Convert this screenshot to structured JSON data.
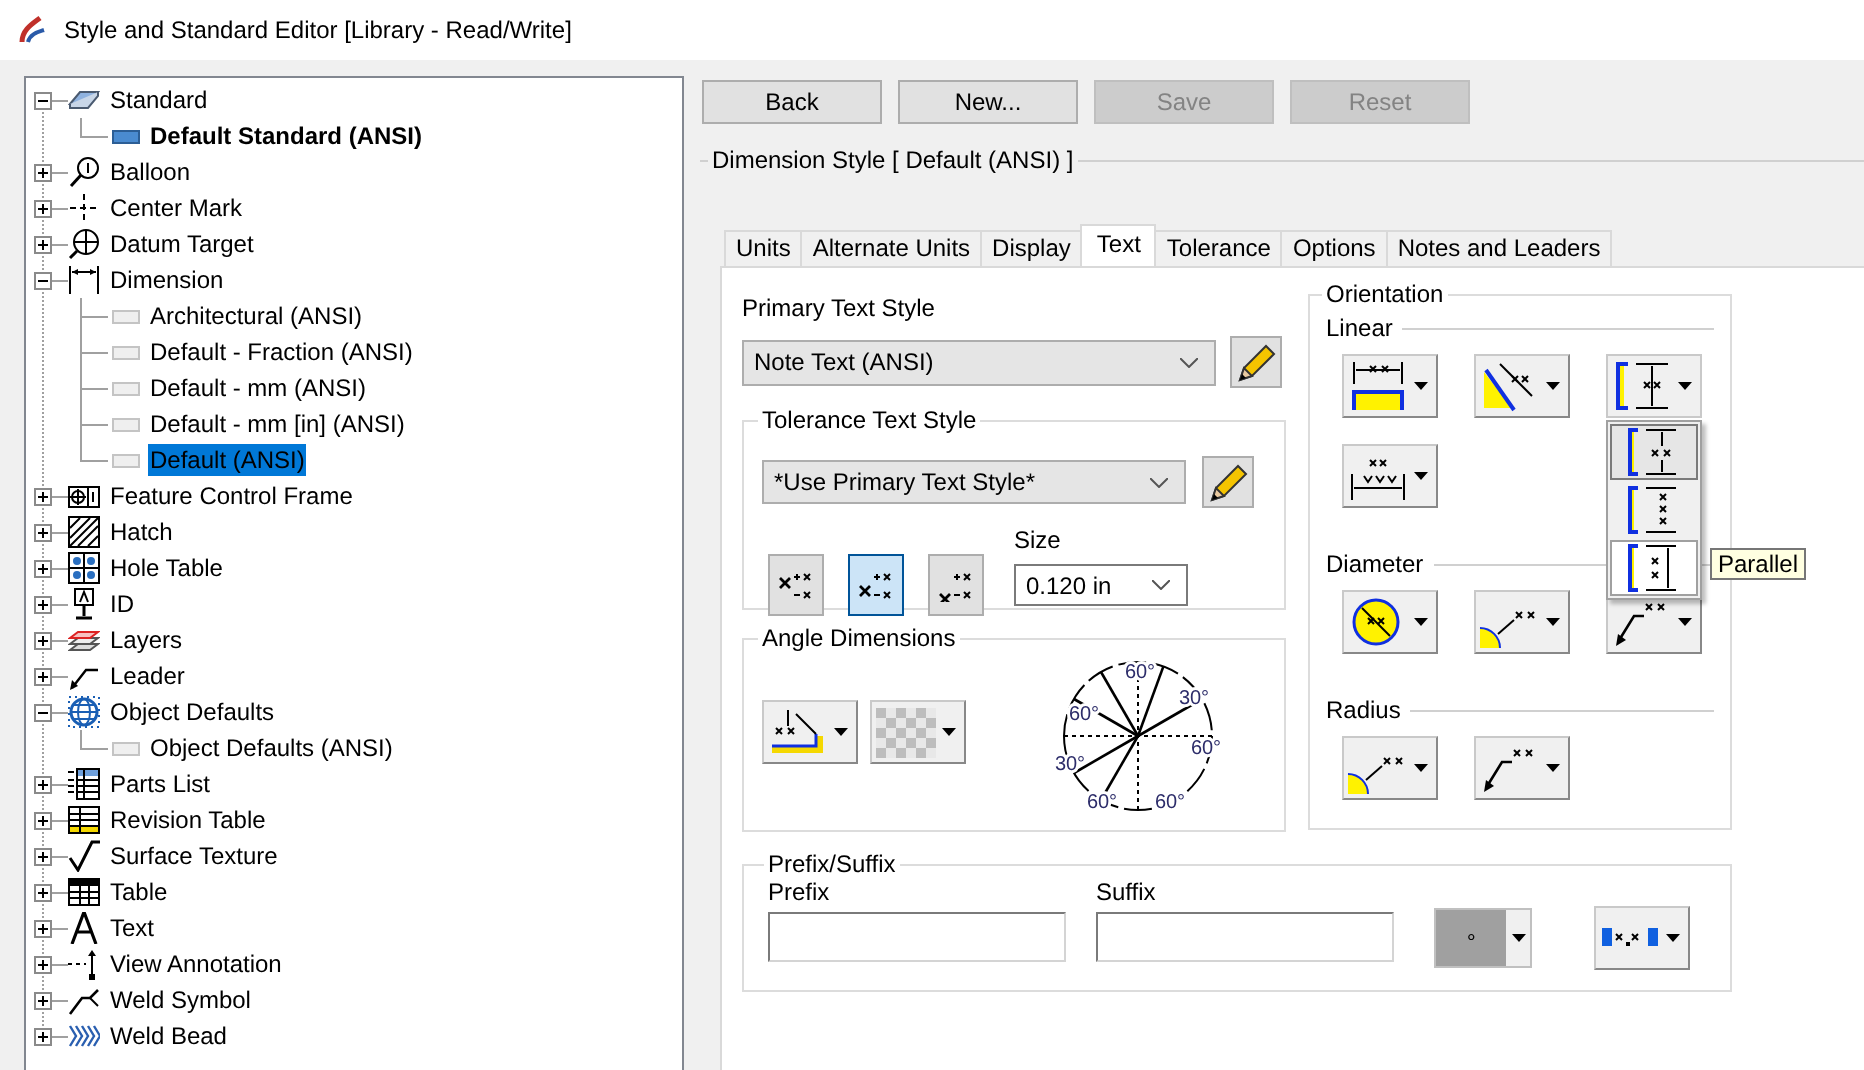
{
  "window": {
    "title": "Style and Standard Editor [Library - Read/Write]"
  },
  "tree": [
    {
      "label": "Standard",
      "kind": "standard",
      "expanded": true,
      "children": [
        {
          "label": "Default Standard (ANSI)",
          "kind": "standard-item",
          "active": true,
          "selected": false
        }
      ]
    },
    {
      "label": "Balloon",
      "kind": "balloon",
      "expanded": false
    },
    {
      "label": "Center Mark",
      "kind": "center-mark",
      "expanded": false
    },
    {
      "label": "Datum Target",
      "kind": "datum-target",
      "expanded": false
    },
    {
      "label": "Dimension",
      "kind": "dimension",
      "expanded": true,
      "children": [
        {
          "label": "Architectural (ANSI)",
          "kind": "style-item",
          "active": false,
          "selected": false
        },
        {
          "label": "Default - Fraction (ANSI)",
          "kind": "style-item",
          "active": false,
          "selected": false
        },
        {
          "label": "Default - mm (ANSI)",
          "kind": "style-item",
          "active": false,
          "selected": false
        },
        {
          "label": "Default - mm [in] (ANSI)",
          "kind": "style-item",
          "active": false,
          "selected": false
        },
        {
          "label": "Default (ANSI)",
          "kind": "style-item",
          "active": false,
          "selected": true
        }
      ]
    },
    {
      "label": "Feature Control Frame",
      "kind": "fcf",
      "expanded": false
    },
    {
      "label": "Hatch",
      "kind": "hatch",
      "expanded": false
    },
    {
      "label": "Hole Table",
      "kind": "hole-table",
      "expanded": false
    },
    {
      "label": "ID",
      "kind": "id",
      "expanded": false
    },
    {
      "label": "Layers",
      "kind": "layers",
      "expanded": false
    },
    {
      "label": "Leader",
      "kind": "leader",
      "expanded": false
    },
    {
      "label": "Object Defaults",
      "kind": "object-defaults",
      "expanded": true,
      "children": [
        {
          "label": "Object Defaults (ANSI)",
          "kind": "style-item",
          "active": false,
          "selected": false
        }
      ]
    },
    {
      "label": "Parts List",
      "kind": "parts-list",
      "expanded": false
    },
    {
      "label": "Revision Table",
      "kind": "revision-table",
      "expanded": false
    },
    {
      "label": "Surface Texture",
      "kind": "surface-texture",
      "expanded": false
    },
    {
      "label": "Table",
      "kind": "table",
      "expanded": false
    },
    {
      "label": "Text",
      "kind": "text",
      "expanded": false
    },
    {
      "label": "View Annotation",
      "kind": "view-annotation",
      "expanded": false
    },
    {
      "label": "Weld Symbol",
      "kind": "weld-symbol",
      "expanded": false
    },
    {
      "label": "Weld Bead",
      "kind": "weld-bead",
      "expanded": false
    }
  ],
  "toolbar": [
    {
      "label": "Back",
      "disabled": false
    },
    {
      "label": "New...",
      "disabled": false
    },
    {
      "label": "Save",
      "disabled": true
    },
    {
      "label": "Reset",
      "disabled": true
    }
  ],
  "style_header": "Dimension Style [ Default (ANSI) ]",
  "tabs": [
    {
      "label": "Units",
      "selected": false
    },
    {
      "label": "Alternate Units",
      "selected": false
    },
    {
      "label": "Display",
      "selected": false
    },
    {
      "label": "Text",
      "selected": true
    },
    {
      "label": "Tolerance",
      "selected": false
    },
    {
      "label": "Options",
      "selected": false
    },
    {
      "label": "Notes and Leaders",
      "selected": false
    }
  ],
  "primary_text_style": {
    "label": "Primary Text Style",
    "value": "Note Text (ANSI)"
  },
  "tolerance_text_style": {
    "title": "Tolerance Text Style",
    "value": "*Use Primary Text Style*",
    "stack_buttons": [
      {
        "kind": "top",
        "selected": false
      },
      {
        "kind": "middle",
        "selected": true
      },
      {
        "kind": "bottom",
        "selected": false
      }
    ],
    "size": {
      "label": "Size",
      "value": "0.120 in"
    }
  },
  "angle_dimensions": {
    "title": "Angle Dimensions",
    "diagram_labels": [
      "60°",
      "30°",
      "60°",
      "60°",
      "30°",
      "60°",
      "60°"
    ]
  },
  "orientation": {
    "title": "Orientation",
    "sections": [
      {
        "title": "Linear",
        "buttons": [
          {
            "kind": "horizontal",
            "open": false
          },
          {
            "kind": "aligned",
            "open": false
          },
          {
            "kind": "vertical",
            "open": true
          },
          {
            "kind": "baseline",
            "open": false
          }
        ]
      },
      {
        "title": "Diameter",
        "buttons": [
          {
            "kind": "circle",
            "open": false
          },
          {
            "kind": "arc-leader",
            "open": false
          },
          {
            "kind": "leader",
            "open": false
          }
        ]
      },
      {
        "title": "Radius",
        "buttons": [
          {
            "kind": "arc-leader",
            "open": false
          },
          {
            "kind": "leader",
            "open": false
          }
        ]
      }
    ],
    "menu": {
      "items": [
        {
          "kind": "horizontal-text",
          "selected": true,
          "hovered": false
        },
        {
          "kind": "stacked-text",
          "selected": false,
          "hovered": false
        },
        {
          "kind": "parallel-text",
          "selected": false,
          "hovered": true
        }
      ],
      "tooltip": "Parallel"
    }
  },
  "prefix_suffix": {
    "title": "Prefix/Suffix",
    "fields": [
      {
        "label": "Prefix"
      },
      {
        "label": "Suffix"
      }
    ],
    "symbol": "∘"
  }
}
